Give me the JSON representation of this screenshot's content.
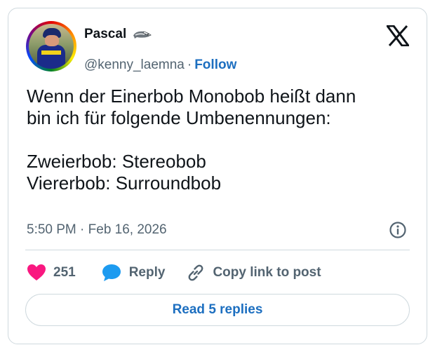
{
  "author": {
    "display_name": "Pascal",
    "badge_icon": "badger-icon",
    "handle": "@kenny_laemna",
    "separator": "·",
    "follow_label": "Follow"
  },
  "brand": {
    "logo_icon": "x-logo-icon"
  },
  "tweet": {
    "lines": [
      "Wenn der Einerbob Monobob heißt dann",
      "bin ich für folgende Umbenennungen:",
      "",
      "Zweierbob: Stereobob",
      "Viererbob: Surroundbob"
    ],
    "timestamp": "5:50 PM · Feb 16, 2026"
  },
  "actions": {
    "like_count": "251",
    "reply_label": "Reply",
    "copy_link_label": "Copy link to post"
  },
  "footer": {
    "read_replies_label": "Read 5 replies"
  },
  "colors": {
    "link_blue": "#1d6fc0",
    "like_pink": "#f91880",
    "reply_blue": "#1d9bf0",
    "muted_text": "#536471",
    "border": "#cfd9de"
  }
}
